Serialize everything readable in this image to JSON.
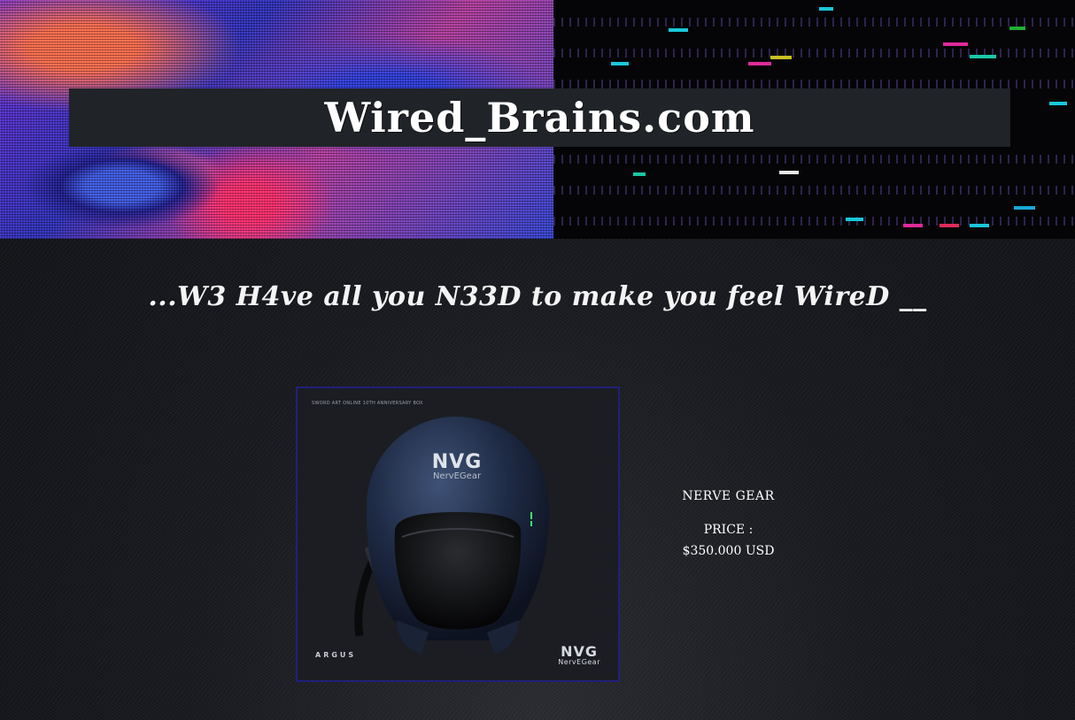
{
  "site": {
    "title": "Wired_Brains.com",
    "tagline": "...W3 H4ve all you N33D to make you feel WireD __"
  },
  "product": {
    "image_caption": "SWORD ART ONLINE 10TH ANNIVERSARY BOX",
    "brand_left": "ARGUS",
    "brand_right_big": "NVG",
    "brand_right_small": "NervEGear",
    "helmet_logo_big": "NVG",
    "helmet_logo_small": "NervEGear",
    "name": "NERVE GEAR",
    "price_label": "PRICE :",
    "price_value": "$350.000 USD"
  },
  "colors": {
    "page_background": "#121318",
    "title_bar": "#202327",
    "card_border": "#20207a",
    "text": "#ffffff"
  }
}
